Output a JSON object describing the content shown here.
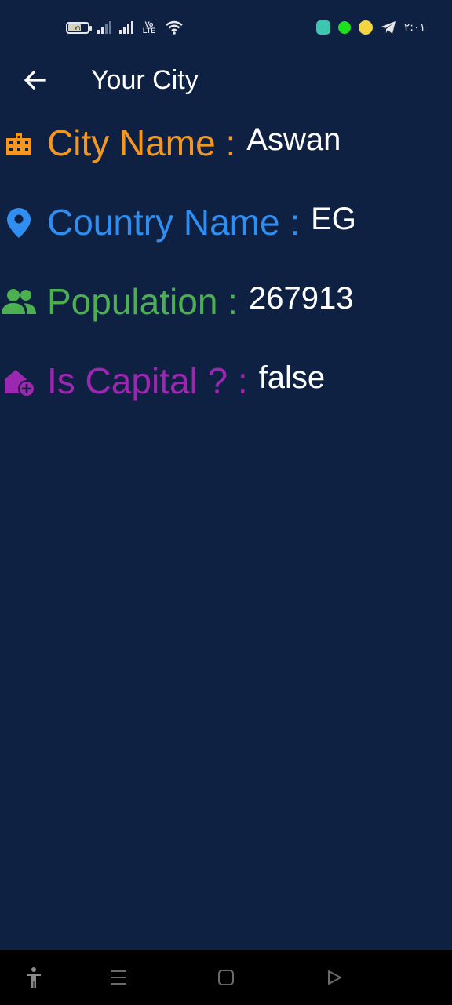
{
  "status_bar": {
    "battery_level": "٧١",
    "volte": "Vo LTE",
    "time": "٢:٠١"
  },
  "app_bar": {
    "title": "Your City",
    "back_icon": "arrow-left-icon"
  },
  "city_info": {
    "city": {
      "label": "City Name :",
      "value": "Aswan",
      "icon": "building-icon",
      "color": "#f5961e"
    },
    "country": {
      "label": "Country Name :",
      "value": "EG",
      "icon": "location-pin-icon",
      "color": "#2f8ef0"
    },
    "population": {
      "label": "Population :",
      "value": "267913",
      "icon": "people-icon",
      "color": "#4caf50"
    },
    "capital": {
      "label": "Is Capital ? :",
      "value": "false",
      "icon": "home-add-icon",
      "color": "#9c27b0"
    }
  },
  "nav_bar": {
    "items": [
      "accessibility-icon",
      "menu-icon",
      "home-square-icon",
      "back-triangle-icon"
    ]
  }
}
